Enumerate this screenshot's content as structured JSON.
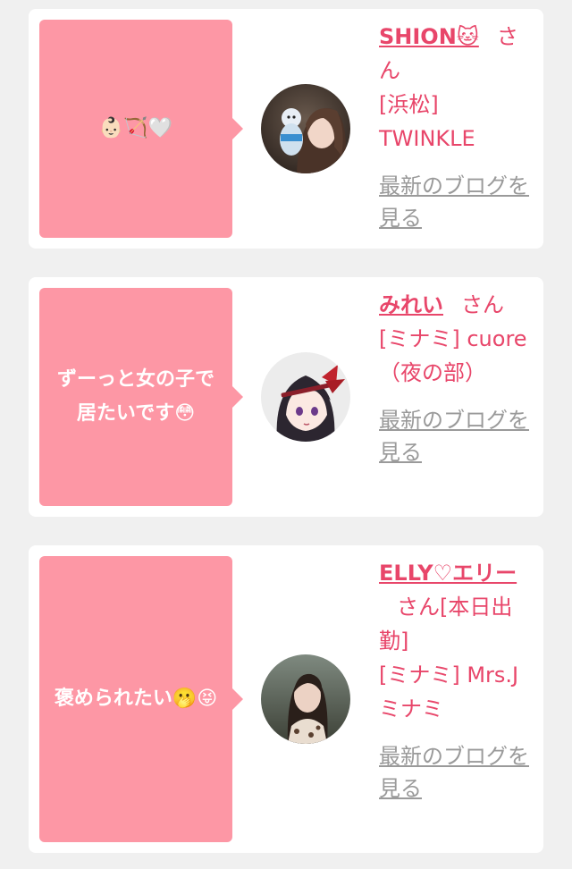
{
  "entries": [
    {
      "message": "👶🏻🏹🤍",
      "name": "SHION🐱",
      "honorific": "さん",
      "shop": "[浜松] TWINKLE",
      "blog_link": "最新のブログを見る",
      "avatar": "woman-holding-plush-photo"
    },
    {
      "message": "ずーっと女の子で居たいです😳",
      "name": "みれい",
      "honorific": "さん",
      "shop": "[ミナミ] cuore（夜の部）",
      "blog_link": "最新のブログを見る",
      "avatar": "anime-girl-with-red-ribbon"
    },
    {
      "message": "褒められたい🫢😝",
      "name": "ELLY♡エリー",
      "honorific": "さん[本日出勤]",
      "shop": "[ミナミ] Mrs.J ミナミ",
      "blog_link": "最新のブログを見る",
      "avatar": "woman-portrait-photo"
    }
  ]
}
